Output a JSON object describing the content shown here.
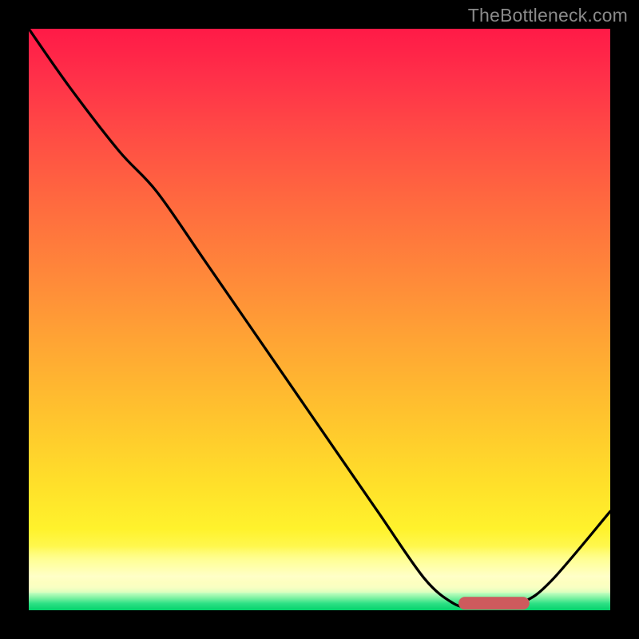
{
  "watermark": "TheBottleneck.com",
  "chart_data": {
    "type": "line",
    "title": "",
    "xlabel": "",
    "ylabel": "",
    "xlim": [
      0,
      100
    ],
    "ylim": [
      0,
      100
    ],
    "grid": false,
    "series": [
      {
        "name": "curve",
        "x": [
          0,
          7,
          15.5,
          22,
          30,
          40,
          50,
          60,
          68,
          73,
          76,
          80,
          85,
          90,
          100
        ],
        "y": [
          100,
          90,
          79,
          72,
          60.5,
          46,
          31.5,
          17,
          5.5,
          1.2,
          0.6,
          0.6,
          1.4,
          5.2,
          17
        ]
      }
    ],
    "annotations": [
      {
        "name": "optimal-range",
        "x0": 75,
        "x1": 85,
        "y": 1.2,
        "color": "#ce5a5d"
      }
    ],
    "gradient_stops_percent_to_color": {
      "0": "#ff1a47",
      "50": "#ff9c36",
      "86": "#fff22c",
      "96": "#f6ffc0",
      "99": "#1ee07f",
      "100": "#05d56e"
    }
  }
}
